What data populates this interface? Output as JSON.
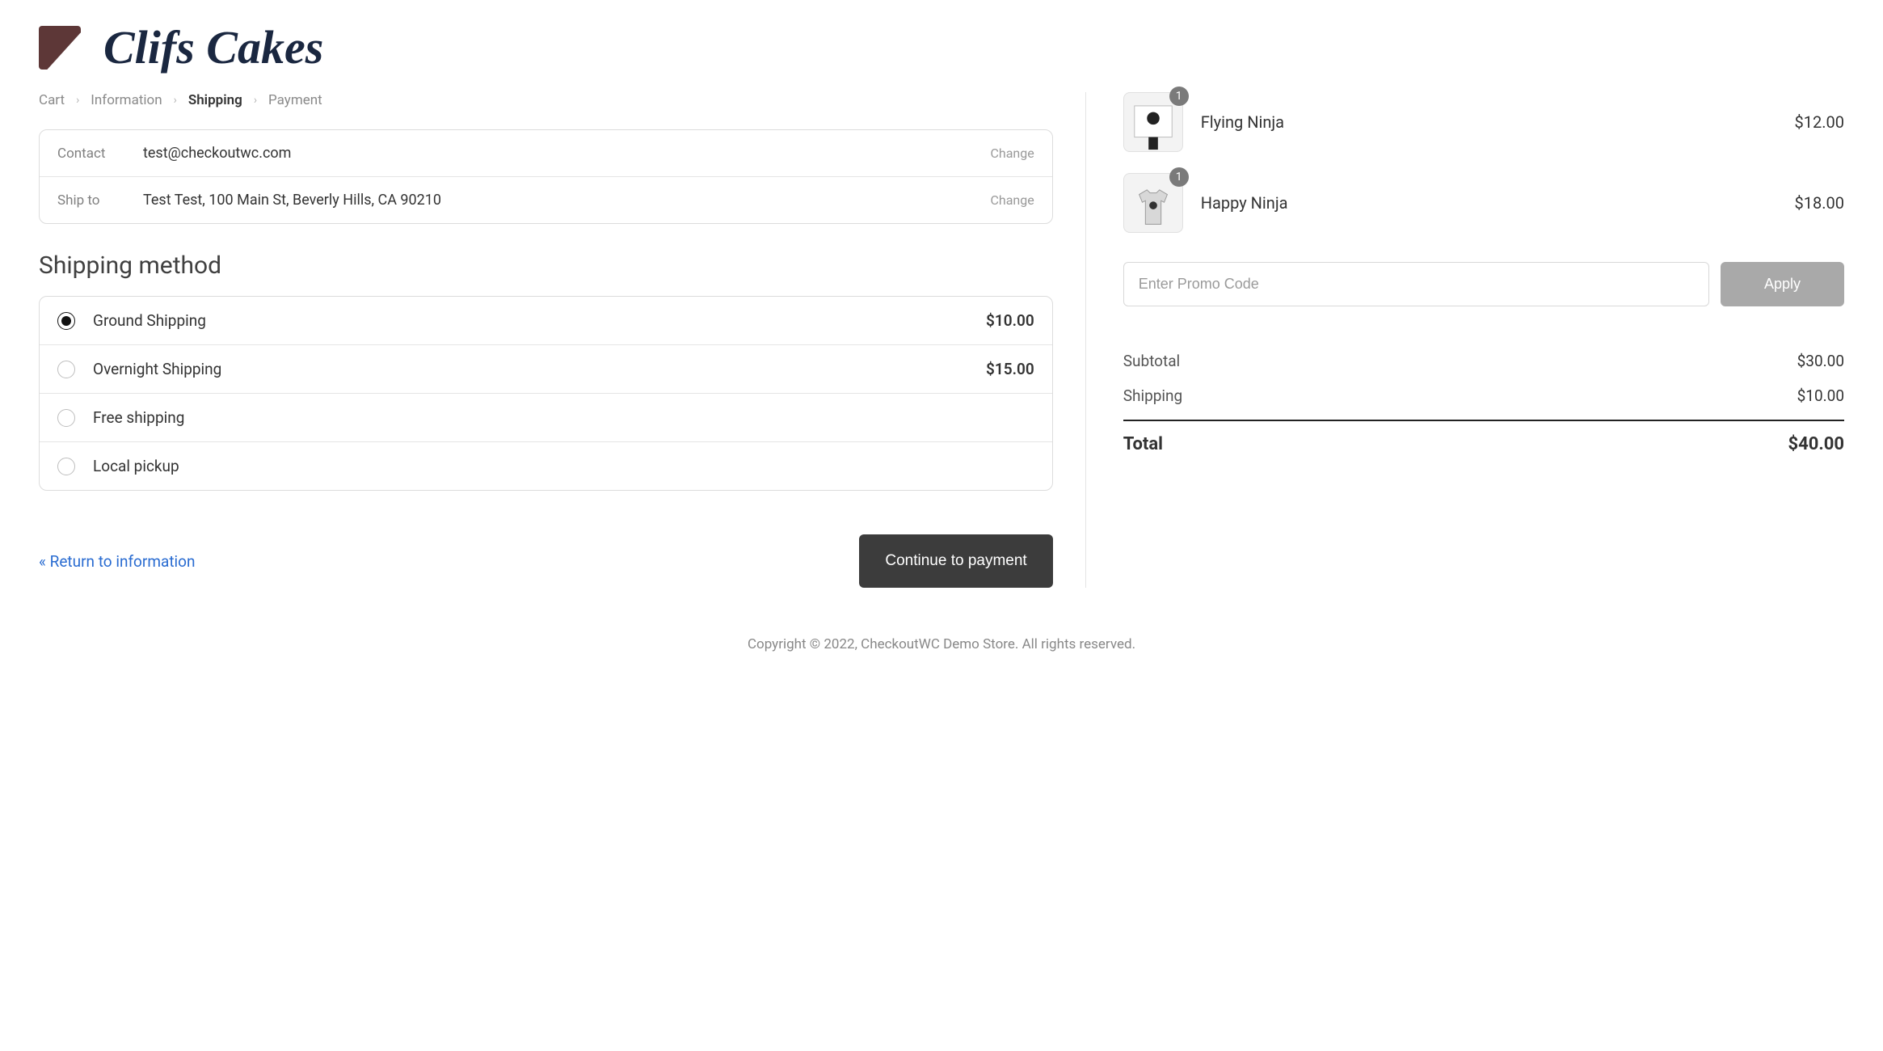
{
  "brand": {
    "name": "Clifs Cakes"
  },
  "breadcrumb": {
    "cart": "Cart",
    "information": "Information",
    "shipping": "Shipping",
    "payment": "Payment"
  },
  "review": {
    "contact_label": "Contact",
    "contact_value": "test@checkoutwc.com",
    "shipto_label": "Ship to",
    "shipto_value": "Test Test, 100 Main St, Beverly Hills, CA 90210",
    "change": "Change"
  },
  "shipping": {
    "title": "Shipping method",
    "options": [
      {
        "label": "Ground Shipping",
        "price": "$10.00",
        "selected": true
      },
      {
        "label": "Overnight Shipping",
        "price": "$15.00",
        "selected": false
      },
      {
        "label": "Free shipping",
        "price": "",
        "selected": false
      },
      {
        "label": "Local pickup",
        "price": "",
        "selected": false
      }
    ]
  },
  "nav": {
    "return": "« Return to information",
    "continue": "Continue to payment"
  },
  "cart": {
    "items": [
      {
        "name": "Flying Ninja",
        "price": "$12.00",
        "qty": "1"
      },
      {
        "name": "Happy Ninja",
        "price": "$18.00",
        "qty": "1"
      }
    ]
  },
  "promo": {
    "placeholder": "Enter Promo Code",
    "apply": "Apply"
  },
  "totals": {
    "subtotal_label": "Subtotal",
    "subtotal": "$30.00",
    "shipping_label": "Shipping",
    "shipping": "$10.00",
    "total_label": "Total",
    "total": "$40.00"
  },
  "footer": "Copyright © 2022, CheckoutWC Demo Store. All rights reserved."
}
